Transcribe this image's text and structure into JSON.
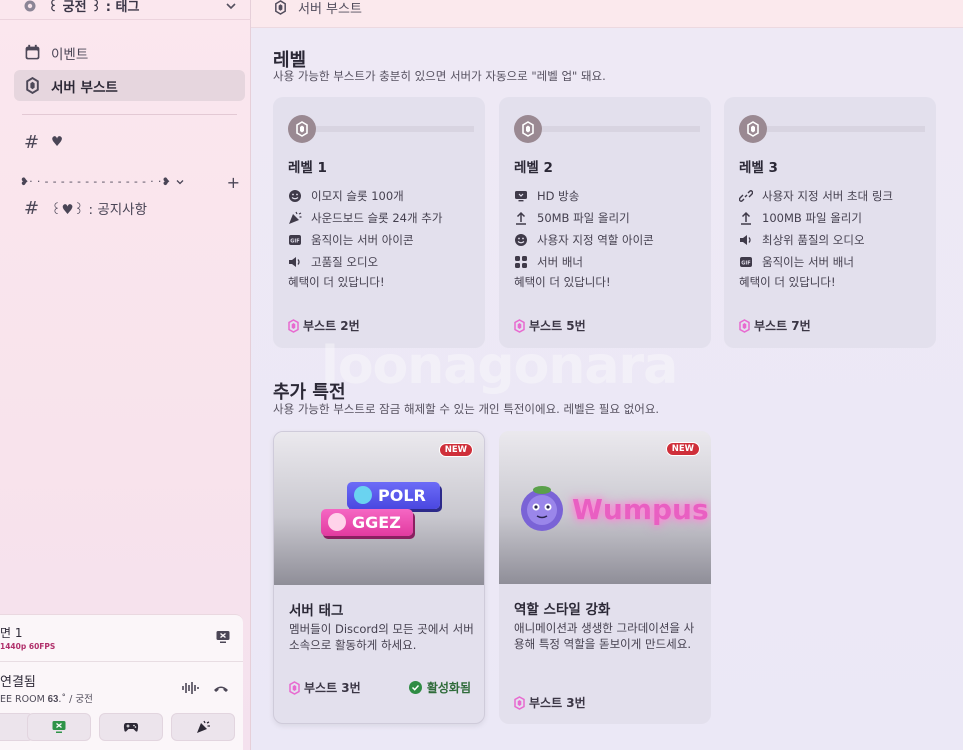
{
  "sidebar": {
    "server_name": "꒰ 궁전 ꒱ : 태그",
    "items": [
      {
        "label": "이벤트",
        "icon": "calendar-icon"
      },
      {
        "label": "서버 부스트",
        "icon": "boost-gem-icon"
      }
    ],
    "channels": [
      {
        "label": "♥",
        "icon": "hash-icon"
      },
      {
        "label": "꒰♥꒱ : 공지사항",
        "icon": "hash-icon"
      }
    ],
    "category_label": "❥· · - - - - - - - - - - - - - · ·❥"
  },
  "voice_panel": {
    "stream_title": "면 1",
    "stream_sub": "1440p 60FPS",
    "connection_title": "연결됨",
    "connection_sub": "EE ROOM 𝟔𝟑.˚ / 궁전"
  },
  "topbar": {
    "title": "서버 부스트"
  },
  "levels_section": {
    "title": "레벨",
    "subtitle": "사용 가능한 부스트가 충분히 있으면 서버가 자동으로 \"레벨 업\" 돼요.",
    "cards": [
      {
        "name": "레벨 1",
        "perks": [
          {
            "icon": "emoji-icon",
            "text": "이모지 슬롯 100개"
          },
          {
            "icon": "soundboard-icon",
            "text": "사운드보드 슬롯 24개 추가"
          },
          {
            "icon": "gif-icon",
            "text": "움직이는 서버 아이콘"
          },
          {
            "icon": "speaker-icon",
            "text": "고품질 오디오"
          }
        ],
        "more": "혜택이 더 있답니다!",
        "boosts": "부스트 2번"
      },
      {
        "name": "레벨 2",
        "perks": [
          {
            "icon": "screen-icon",
            "text": "HD 방송"
          },
          {
            "icon": "upload-icon",
            "text": "50MB 파일 올리기"
          },
          {
            "icon": "emoji-icon",
            "text": "사용자 지정 역할 아이콘"
          },
          {
            "icon": "grid-icon",
            "text": "서버 배너"
          }
        ],
        "more": "혜택이 더 있답니다!",
        "boosts": "부스트 5번"
      },
      {
        "name": "레벨 3",
        "perks": [
          {
            "icon": "link-icon",
            "text": "사용자 지정 서버 초대 링크"
          },
          {
            "icon": "upload-icon",
            "text": "100MB 파일 올리기"
          },
          {
            "icon": "speaker-icon",
            "text": "최상위 품질의 오디오"
          },
          {
            "icon": "gif-icon",
            "text": "움직이는 서버 배너"
          }
        ],
        "more": "혜택이 더 있답니다!",
        "boosts": "부스트 7번"
      }
    ]
  },
  "perks_section": {
    "title": "추가 특전",
    "subtitle": "사용 가능한 부스트로 잠금 해제할 수 있는 개인 특전이에요. 레벨은 필요 없어요.",
    "cards": [
      {
        "badge": "NEW",
        "title": "서버 태그",
        "desc": "멤버들이 Discord의 모든 곳에서 서버 소속으로 활동하게 하세요.",
        "boosts": "부스트 3번",
        "status": "활성화됨",
        "tag1": "POLR",
        "tag2": "GGEZ"
      },
      {
        "badge": "NEW",
        "title": "역할 스타일 강화",
        "desc": "애니메이션과 생생한 그라데이션을 사용해 특정 역할을 돋보이게 만드세요.",
        "boosts": "부스트 3번",
        "wumpus": "Wumpus"
      }
    ]
  },
  "watermark": "loonagonara",
  "colors": {
    "boost_pink": "#e86ad0",
    "badge_red": "#cf2f3a",
    "active_green": "#2f8c44"
  }
}
